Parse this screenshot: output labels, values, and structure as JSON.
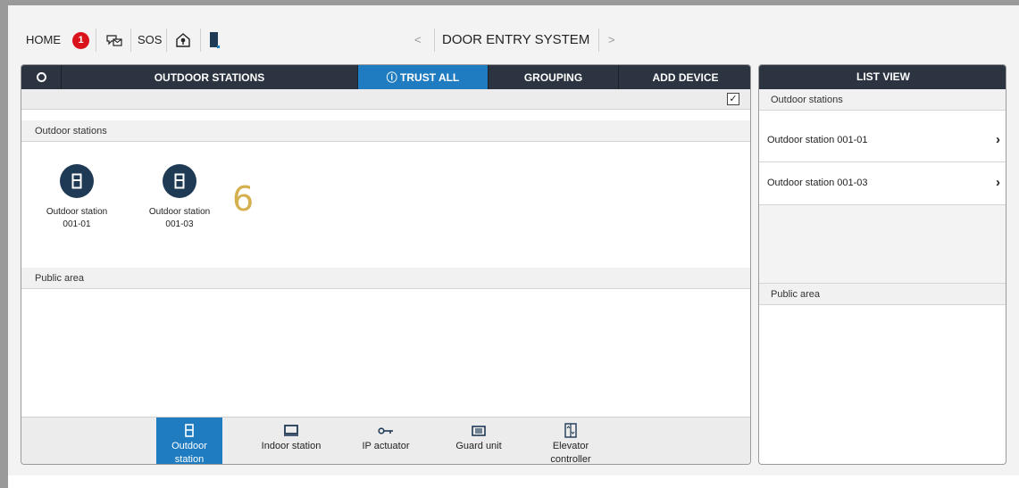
{
  "header": {
    "home_label": "HOME",
    "alarm_count": "1",
    "sos_label": "SOS",
    "prev_arrow": "<",
    "title": "DOOR ENTRY SYSTEM",
    "next_arrow": ">"
  },
  "tabs": {
    "outdoor_stations": "OUTDOOR STATIONS",
    "trust_all": "ⓘ TRUST ALL",
    "grouping": "GROUPING",
    "add_device": "ADD DEVICE"
  },
  "toolbar": {
    "select_all_mark": "✓"
  },
  "sections": {
    "outdoor": "Outdoor stations",
    "public": "Public area"
  },
  "devices": [
    {
      "label_line1": "Outdoor station",
      "label_line2": "001-01"
    },
    {
      "label_line1": "Outdoor station",
      "label_line2": "001-03"
    }
  ],
  "annotation_number": "6",
  "device_types": [
    {
      "label": "Outdoor station",
      "active": true
    },
    {
      "label": "Indoor station",
      "active": false
    },
    {
      "label": "IP actuator",
      "active": false
    },
    {
      "label": "Guard unit",
      "active": false
    },
    {
      "label_line1": "Elevator",
      "label_line2": "controller",
      "active": false
    }
  ],
  "list_view": {
    "title": "LIST VIEW",
    "outdoor_section": "Outdoor stations",
    "items": [
      {
        "label": "Outdoor station 001-01",
        "chevron": "›"
      },
      {
        "label": "Outdoor station 001-03",
        "chevron": "›"
      }
    ],
    "public_section": "Public area"
  },
  "colors": {
    "tab_bar": "#2b3440",
    "accent": "#1f7cc0",
    "device_icon": "#1f3a55",
    "alarm": "#d9121b",
    "annotation": "#d4b04e"
  }
}
